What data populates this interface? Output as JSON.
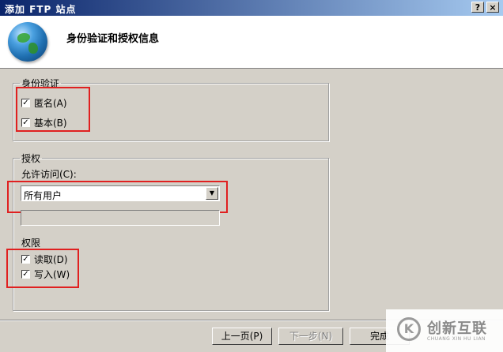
{
  "window": {
    "title": "添加 FTP 站点",
    "help_label": "?",
    "close_label": "×"
  },
  "header": {
    "title": "身份验证和授权信息"
  },
  "authentication": {
    "legend": "身份验证",
    "anonymous": {
      "label": "匿名(A)",
      "checked": true
    },
    "basic": {
      "label": "基本(B)",
      "checked": true
    }
  },
  "authorization": {
    "legend": "授权",
    "allow_access_label": "允许访问(C):",
    "allow_access_value": "所有用户",
    "permissions": {
      "legend": "权限",
      "read": {
        "label": "读取(D)",
        "checked": true
      },
      "write": {
        "label": "写入(W)",
        "checked": true
      }
    }
  },
  "buttons": {
    "previous": "上一页(P)",
    "next": "下一步(N)",
    "finish": "完成"
  },
  "watermark": {
    "logo": "K",
    "text": "创新互联",
    "subtext": "CHUANG XIN HU LIAN"
  }
}
